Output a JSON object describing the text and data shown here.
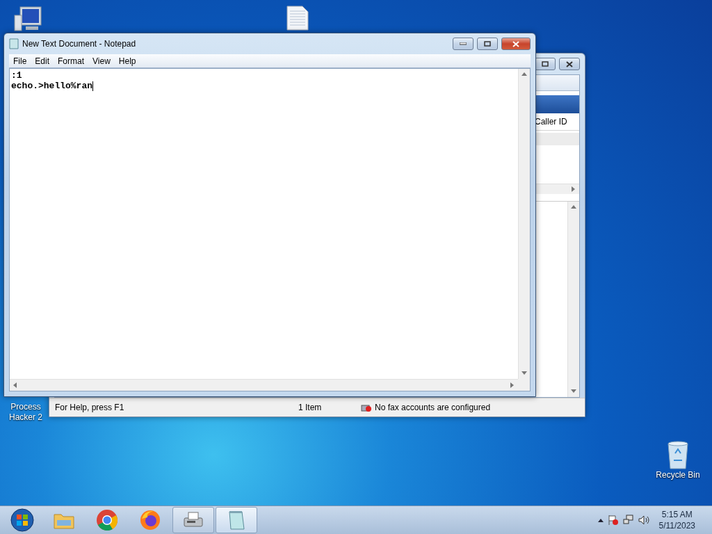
{
  "desktop_icons": [
    {
      "kind": "computer"
    },
    {
      "kind": "document"
    }
  ],
  "desktop_labels": [
    {
      "kind": "app",
      "label": "Process Hacker 2"
    },
    {
      "kind": "recycle",
      "label": "Recycle Bin"
    }
  ],
  "back_window": {
    "column_header": "Caller ID",
    "status_bar": {
      "help": "For Help, press F1",
      "count": "1 Item",
      "fax_status": "No fax accounts are configured"
    }
  },
  "notepad": {
    "title": "New Text Document - Notepad",
    "menu": [
      "File",
      "Edit",
      "Format",
      "View",
      "Help"
    ],
    "lines": [
      ":1",
      "echo.>hello%ran"
    ]
  },
  "taskbar": {
    "items": [
      {
        "kind": "explorer",
        "open": false,
        "selected": false
      },
      {
        "kind": "chrome",
        "open": false,
        "selected": false
      },
      {
        "kind": "firefox",
        "open": false,
        "selected": false
      },
      {
        "kind": "fax",
        "open": true,
        "selected": false
      },
      {
        "kind": "notepad",
        "open": true,
        "selected": true
      }
    ],
    "clock": {
      "time": "5:15 AM",
      "date": "5/11/2023"
    }
  }
}
